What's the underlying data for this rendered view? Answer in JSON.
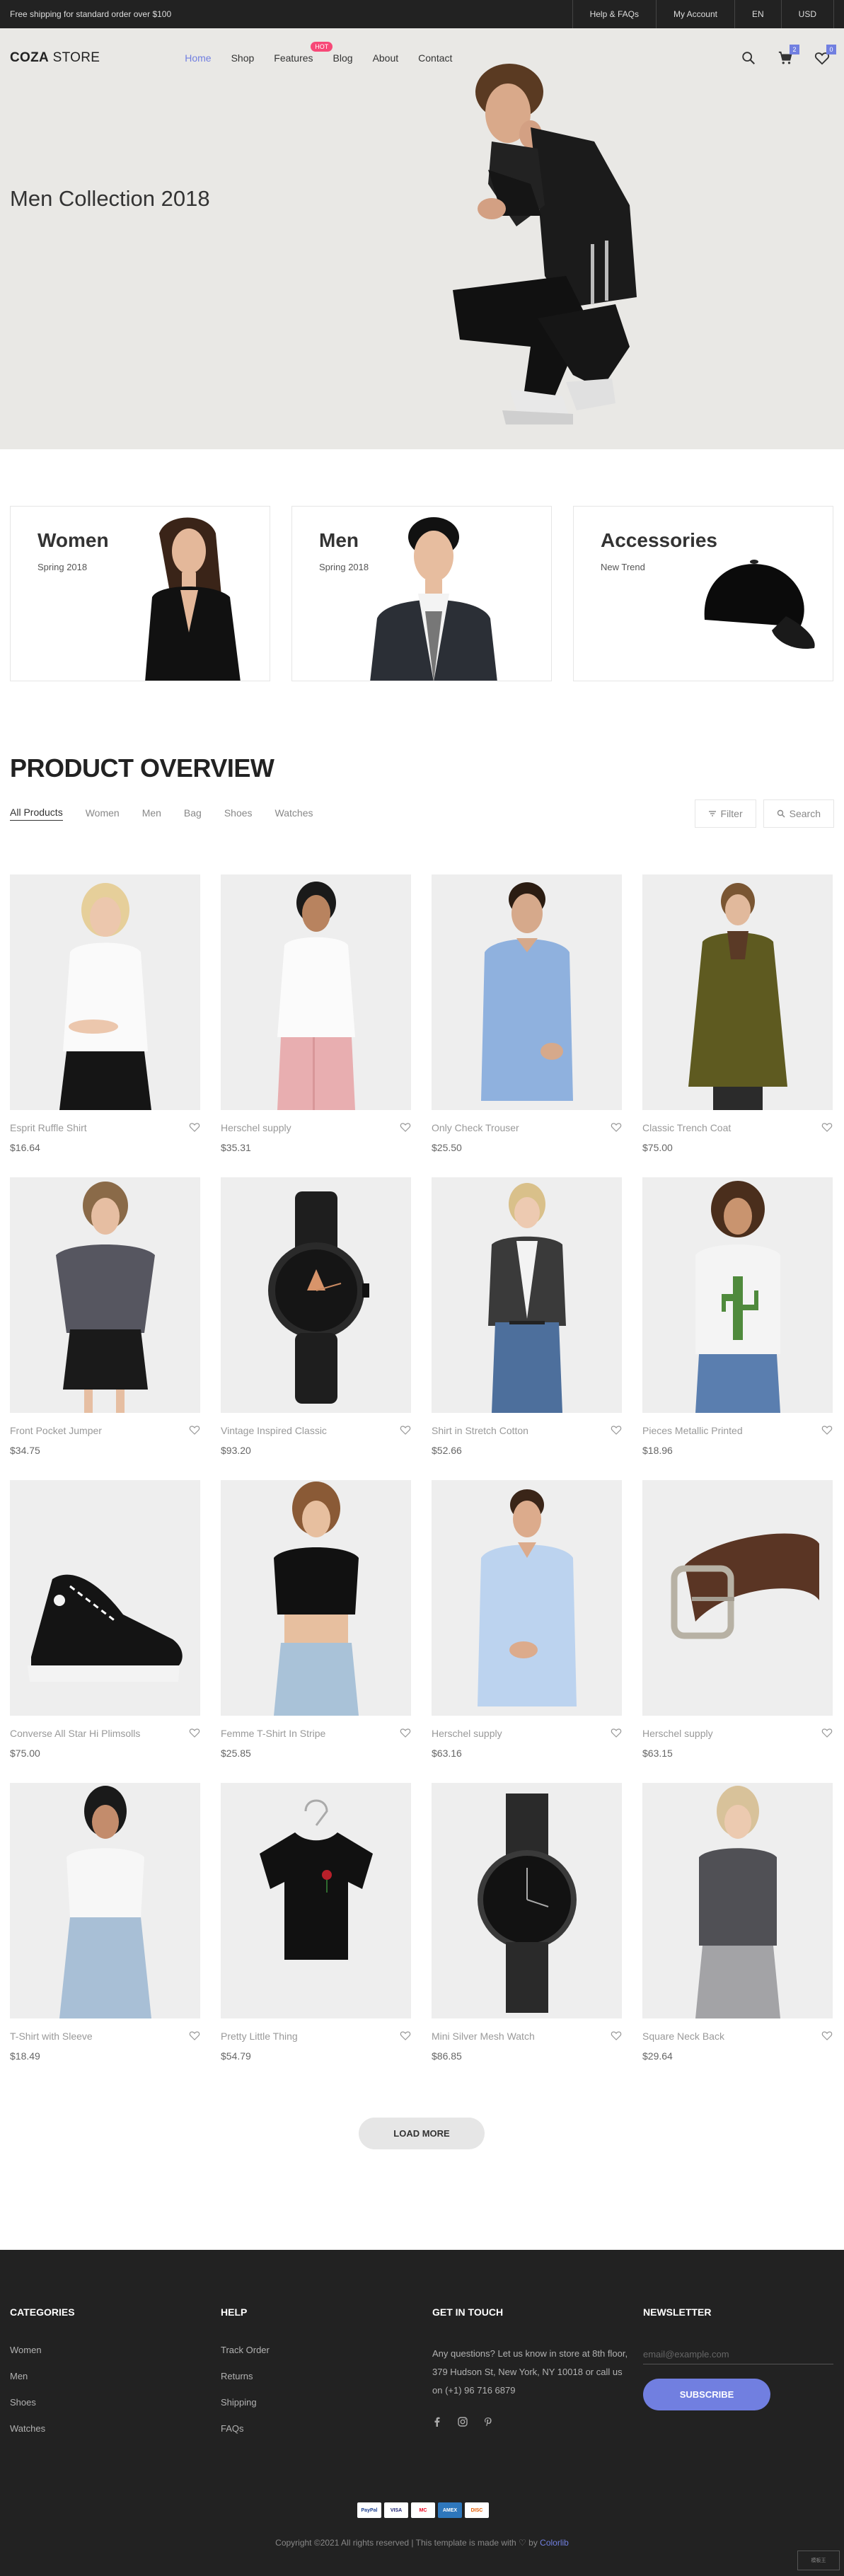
{
  "topbar": {
    "shipping": "Free shipping for standard order over $100",
    "links": [
      "Help & FAQs",
      "My Account",
      "EN",
      "USD"
    ]
  },
  "header": {
    "logo_bold": "COZA",
    "logo_rest": " STORE",
    "nav": [
      "Home",
      "Shop",
      "Features",
      "Blog",
      "About",
      "Contact"
    ],
    "hot_badge": "HOT",
    "cart_count": "2",
    "wishlist_count": "0"
  },
  "hero": {
    "title": "Men Collection 2018"
  },
  "banners": [
    {
      "title": "Women",
      "subtitle": "Spring 2018"
    },
    {
      "title": "Men",
      "subtitle": "Spring 2018"
    },
    {
      "title": "Accessories",
      "subtitle": "New Trend"
    }
  ],
  "overview": {
    "title": "PRODUCT OVERVIEW",
    "filters": [
      "All Products",
      "Women",
      "Men",
      "Bag",
      "Shoes",
      "Watches"
    ],
    "filter_button": "Filter",
    "search_button": "Search"
  },
  "products": [
    {
      "name": "Esprit Ruffle Shirt",
      "price": "$16.64",
      "icon": "woman-white-tee"
    },
    {
      "name": "Herschel supply",
      "price": "$35.31",
      "icon": "woman-white-shirt-pink-pants"
    },
    {
      "name": "Only Check Trouser",
      "price": "$25.50",
      "icon": "man-blue-shirt"
    },
    {
      "name": "Classic Trench Coat",
      "price": "$75.00",
      "icon": "woman-trench-coat"
    },
    {
      "name": "Front Pocket Jumper",
      "price": "$34.75",
      "icon": "woman-grey-jumper"
    },
    {
      "name": "Vintage Inspired Classic",
      "price": "$93.20",
      "icon": "black-watch"
    },
    {
      "name": "Shirt in Stretch Cotton",
      "price": "$52.66",
      "icon": "woman-blazer-jeans"
    },
    {
      "name": "Pieces Metallic Printed",
      "price": "$18.96",
      "icon": "woman-cactus-tee"
    },
    {
      "name": "Converse All Star Hi Plimsolls",
      "price": "$75.00",
      "icon": "black-sneaker"
    },
    {
      "name": "Femme T-Shirt In Stripe",
      "price": "$25.85",
      "icon": "woman-black-crop"
    },
    {
      "name": "Herschel supply",
      "price": "$63.16",
      "icon": "man-light-blue-shirt"
    },
    {
      "name": "Herschel supply",
      "price": "$63.15",
      "icon": "leather-belt"
    },
    {
      "name": "T-Shirt with Sleeve",
      "price": "$18.49",
      "icon": "woman-white-tee-jeans"
    },
    {
      "name": "Pretty Little Thing",
      "price": "$54.79",
      "icon": "black-tee-hanger"
    },
    {
      "name": "Mini Silver Mesh Watch",
      "price": "$86.85",
      "icon": "mesh-watch"
    },
    {
      "name": "Square Neck Back",
      "price": "$29.64",
      "icon": "woman-grey-tee"
    }
  ],
  "load_more": "LOAD MORE",
  "footer": {
    "categories": {
      "title": "CATEGORIES",
      "links": [
        "Women",
        "Men",
        "Shoes",
        "Watches"
      ]
    },
    "help": {
      "title": "HELP",
      "links": [
        "Track Order",
        "Returns",
        "Shipping",
        "FAQs"
      ]
    },
    "contact": {
      "title": "GET IN TOUCH",
      "text": "Any questions? Let us know in store at 8th floor, 379 Hudson St, New York, NY 10018 or call us on (+1) 96 716 6879"
    },
    "newsletter": {
      "title": "NEWSLETTER",
      "placeholder": "email@example.com",
      "button": "SUBSCRIBE"
    },
    "payments": [
      "PayPal",
      "VISA",
      "MC",
      "AMEX",
      "DISC"
    ],
    "copyright_text": "Copyright ©2021 All rights reserved | This template is made with ♡ by ",
    "copyright_link": "Colorlib"
  },
  "colors": {
    "accent": "#717fe0",
    "hot": "#f74877",
    "dark": "#222222",
    "hero_bg": "#e9e8e5"
  }
}
